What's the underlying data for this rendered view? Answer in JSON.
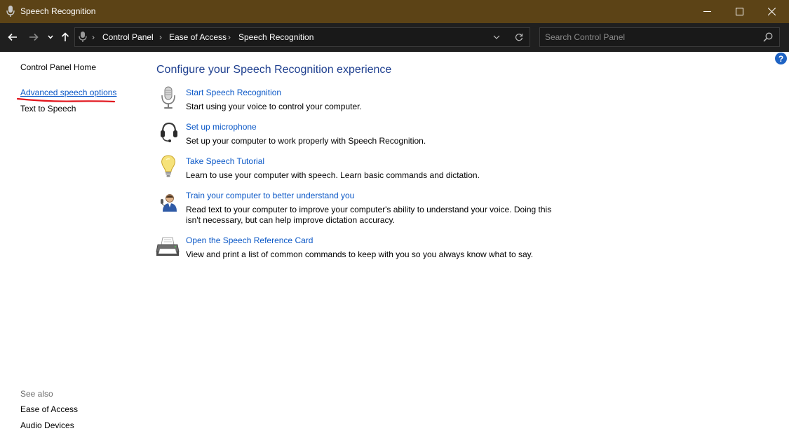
{
  "window": {
    "title": "Speech Recognition"
  },
  "nav": {
    "breadcrumbs": [
      "Control Panel",
      "Ease of Access",
      "Speech Recognition"
    ],
    "separator": "›",
    "search_placeholder": "Search Control Panel"
  },
  "left": {
    "home": "Control Panel Home",
    "advanced": "Advanced speech options",
    "tts": "Text to Speech",
    "see_also": "See also",
    "see_also_links": [
      "Ease of Access",
      "Audio Devices"
    ],
    "annotation_color": "#e1141c"
  },
  "main": {
    "heading": "Configure your Speech Recognition experience",
    "tasks": [
      {
        "icon": "microphone-icon",
        "link": "Start Speech Recognition",
        "desc": "Start using your voice to control your computer."
      },
      {
        "icon": "headset-icon",
        "link": "Set up microphone",
        "desc": "Set up your computer to work properly with Speech Recognition."
      },
      {
        "icon": "lightbulb-icon",
        "link": "Take Speech Tutorial",
        "desc": "Learn to use your computer with speech.  Learn basic commands and dictation."
      },
      {
        "icon": "user-train-icon",
        "link": "Train your computer to better understand you",
        "desc": "Read text to your computer to improve your computer's ability to understand your voice.  Doing this isn't necessary, but can help improve dictation accuracy."
      },
      {
        "icon": "printer-icon",
        "link": "Open the Speech Reference Card",
        "desc": "View and print a list of common commands to keep with you so you always know what to say."
      }
    ]
  },
  "colors": {
    "titlebar": "#5c4316",
    "navbar": "#1f1f1f",
    "link": "#0b58c7",
    "heading": "#1e3f8f"
  }
}
